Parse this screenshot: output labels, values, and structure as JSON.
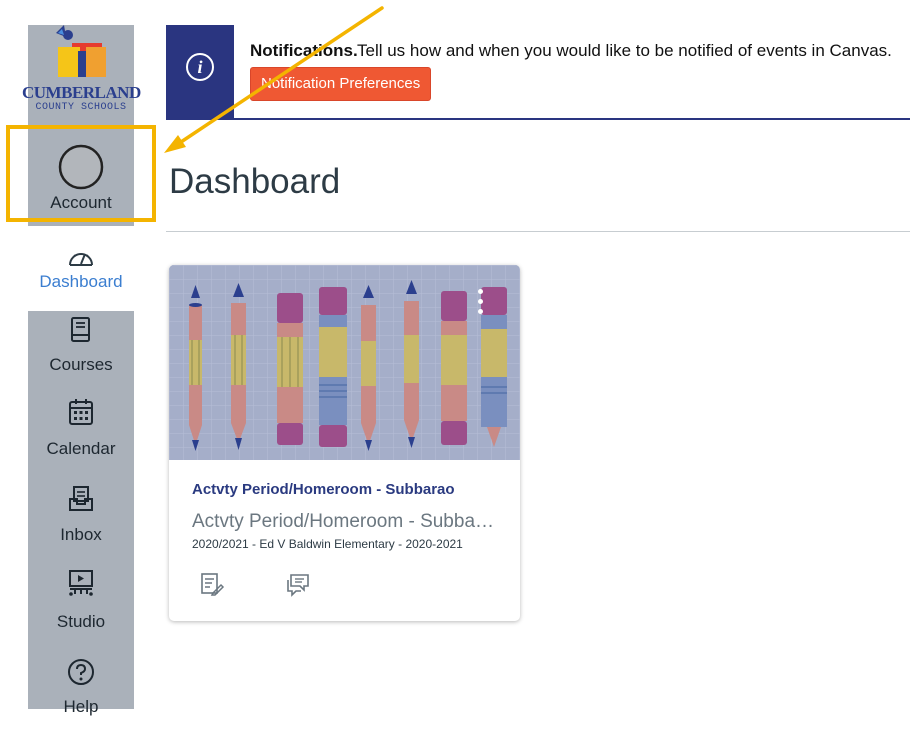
{
  "logo": {
    "line1": "CUMBERLAND",
    "line2": "COUNTY SCHOOLS"
  },
  "nav": {
    "account": "Account",
    "dashboard": "Dashboard",
    "courses": "Courses",
    "calendar": "Calendar",
    "inbox": "Inbox",
    "studio": "Studio",
    "help": "Help"
  },
  "banner": {
    "icon": "i",
    "title": "Notifications.",
    "text": "Tell us how and when you would like to be notified of events in Canvas.",
    "button": "Notification Preferences"
  },
  "page": {
    "title": "Dashboard"
  },
  "card": {
    "title": "Actvty Period/Homeroom - Subbarao",
    "code": "Actvty Period/Homeroom - Subbarao",
    "term": "2020/2021 - Ed V Baldwin Elementary - 2020-2021"
  },
  "colors": {
    "nav_bg": "#aab1ba",
    "banner_accent": "#2a3580",
    "button": "#ef5833",
    "active_link": "#3b7ed0",
    "highlight": "#f4b400",
    "card_hero": "#a5aec9"
  }
}
